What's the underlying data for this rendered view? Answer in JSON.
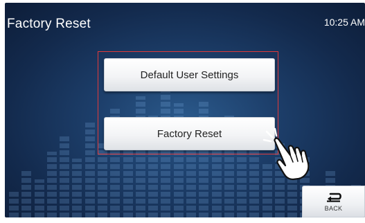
{
  "header": {
    "title": "Factory Reset",
    "time": "10:25 AM"
  },
  "main": {
    "buttons": [
      {
        "label": "Default User Settings"
      },
      {
        "label": "Factory Reset"
      }
    ]
  },
  "footer": {
    "back_label": "BACK",
    "back_icon": "return-arrow-icon"
  },
  "colors": {
    "background": "#1d3f6b",
    "highlight": "#e23a3a",
    "button_face": "#f3f4f6",
    "text_light": "#ffffff"
  },
  "icons": {
    "pointer": "tapping-hand-icon"
  }
}
